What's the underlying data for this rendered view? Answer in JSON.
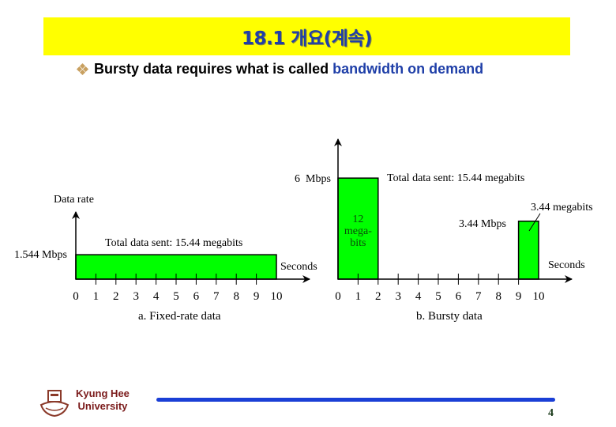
{
  "slide": {
    "title": "18.1 개요(계속)",
    "bullet": {
      "icon": "diamond-bullet-icon",
      "text_plain": "Bursty data requires what is called",
      "text_highlight": "bandwidth on demand"
    },
    "footer": {
      "university_line1": "Kyung Hee",
      "university_line2": "University",
      "page_number": "4"
    },
    "colors": {
      "title_bg": "#ffff00",
      "title_text": "#1f3fa8",
      "highlight_text": "#1f3fa8",
      "bar_fill": "#00ff00",
      "footer_line": "#1a3fd6",
      "university_text": "#7a1a1a"
    }
  },
  "chart_data": [
    {
      "type": "bar",
      "title": "a. Fixed-rate data",
      "ylabel": "Data rate",
      "xlabel": "Seconds",
      "x_ticks": [
        "0",
        "1",
        "2",
        "3",
        "4",
        "5",
        "6",
        "7",
        "8",
        "9",
        "10"
      ],
      "xlim": [
        0,
        10
      ],
      "y_level_label": "1.544 Mbps",
      "annotation": "Total data sent: 15.44 megabits",
      "bars": [
        {
          "x_start": 0,
          "x_end": 10,
          "rate_mbps": 1.544,
          "label": ""
        }
      ]
    },
    {
      "type": "bar",
      "title": "b. Bursty data",
      "ylabel": "",
      "xlabel": "Seconds",
      "x_ticks": [
        "0",
        "1",
        "2",
        "3",
        "4",
        "5",
        "6",
        "7",
        "8",
        "9",
        "10"
      ],
      "xlim": [
        0,
        10
      ],
      "y_level_label": "6  Mbps",
      "annotation": "Total data sent: 15.44 megabits",
      "bars": [
        {
          "x_start": 0,
          "x_end": 2,
          "rate_mbps": 6,
          "label_lines": [
            "12",
            "mega-",
            "bits"
          ]
        },
        {
          "x_start": 9,
          "x_end": 10,
          "rate_mbps": 3.44,
          "rate_label": "3.44 Mbps",
          "callout": "3.44 megabits"
        }
      ]
    }
  ]
}
